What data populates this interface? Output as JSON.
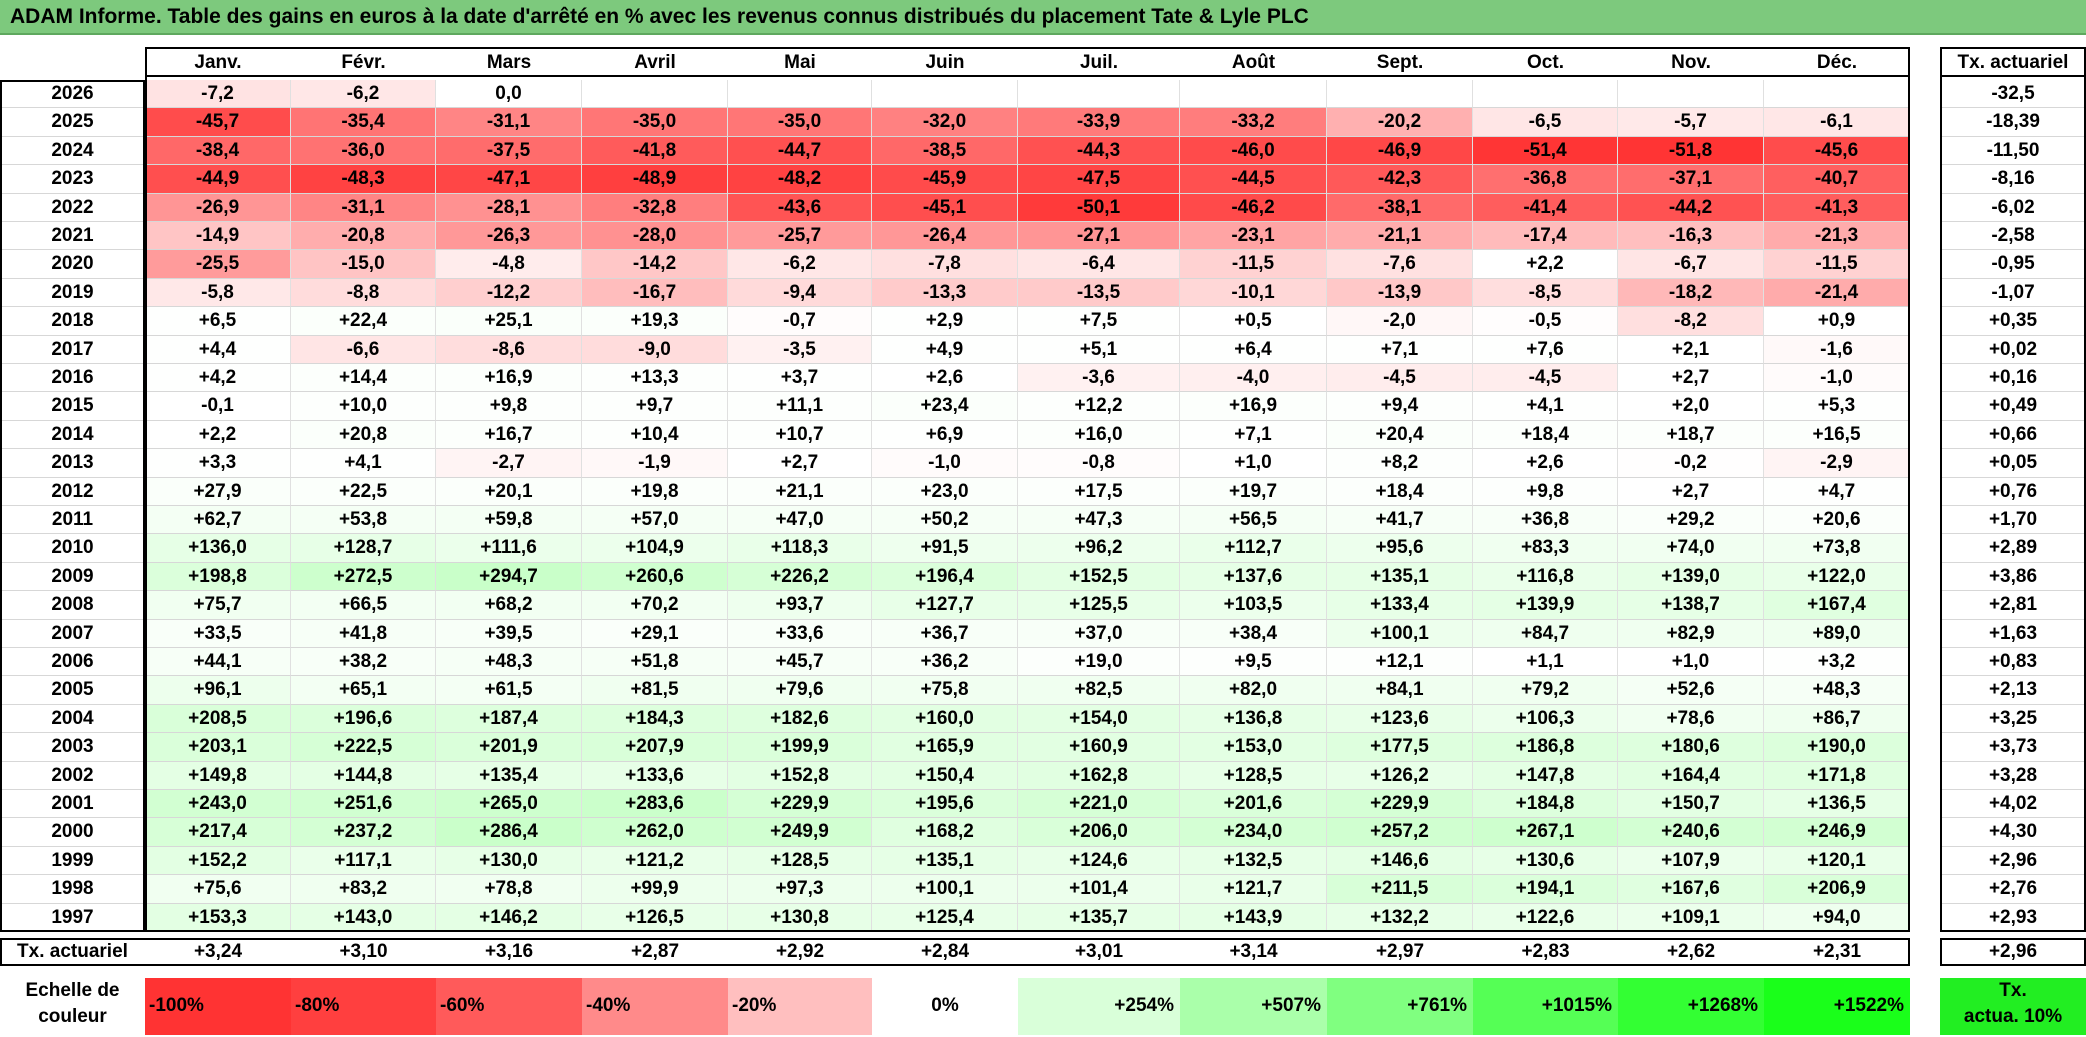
{
  "title": "ADAM Informe. Table des gains en euros à la date d'arrêté en % avec les revenus connus distribués du placement Tate & Lyle PLC",
  "months": [
    "Janv.",
    "Févr.",
    "Mars",
    "Avril",
    "Mai",
    "Juin",
    "Juil.",
    "Août",
    "Sept.",
    "Oct.",
    "Nov.",
    "Déc."
  ],
  "actuarial_header": "Tx. actuariel",
  "rows": [
    {
      "year": "2026",
      "values": [
        "-7,2",
        "-6,2",
        "0,0",
        "",
        "",
        "",
        "",
        "",
        "",
        "",
        "",
        ""
      ],
      "rate": "-32,5"
    },
    {
      "year": "2025",
      "values": [
        "-45,7",
        "-35,4",
        "-31,1",
        "-35,0",
        "-35,0",
        "-32,0",
        "-33,9",
        "-33,2",
        "-20,2",
        "-6,5",
        "-5,7",
        "-6,1"
      ],
      "rate": "-18,39"
    },
    {
      "year": "2024",
      "values": [
        "-38,4",
        "-36,0",
        "-37,5",
        "-41,8",
        "-44,7",
        "-38,5",
        "-44,3",
        "-46,0",
        "-46,9",
        "-51,4",
        "-51,8",
        "-45,6"
      ],
      "rate": "-11,50"
    },
    {
      "year": "2023",
      "values": [
        "-44,9",
        "-48,3",
        "-47,1",
        "-48,9",
        "-48,2",
        "-45,9",
        "-47,5",
        "-44,5",
        "-42,3",
        "-36,8",
        "-37,1",
        "-40,7"
      ],
      "rate": "-8,16"
    },
    {
      "year": "2022",
      "values": [
        "-26,9",
        "-31,1",
        "-28,1",
        "-32,8",
        "-43,6",
        "-45,1",
        "-50,1",
        "-46,2",
        "-38,1",
        "-41,4",
        "-44,2",
        "-41,3"
      ],
      "rate": "-6,02"
    },
    {
      "year": "2021",
      "values": [
        "-14,9",
        "-20,8",
        "-26,3",
        "-28,0",
        "-25,7",
        "-26,4",
        "-27,1",
        "-23,1",
        "-21,1",
        "-17,4",
        "-16,3",
        "-21,3"
      ],
      "rate": "-2,58"
    },
    {
      "year": "2020",
      "values": [
        "-25,5",
        "-15,0",
        "-4,8",
        "-14,2",
        "-6,2",
        "-7,8",
        "-6,4",
        "-11,5",
        "-7,6",
        "+2,2",
        "-6,7",
        "-11,5"
      ],
      "rate": "-0,95"
    },
    {
      "year": "2019",
      "values": [
        "-5,8",
        "-8,8",
        "-12,2",
        "-16,7",
        "-9,4",
        "-13,3",
        "-13,5",
        "-10,1",
        "-13,9",
        "-8,5",
        "-18,2",
        "-21,4"
      ],
      "rate": "-1,07"
    },
    {
      "year": "2018",
      "values": [
        "+6,5",
        "+22,4",
        "+25,1",
        "+19,3",
        "-0,7",
        "+2,9",
        "+7,5",
        "+0,5",
        "-2,0",
        "-0,5",
        "-8,2",
        "+0,9"
      ],
      "rate": "+0,35"
    },
    {
      "year": "2017",
      "values": [
        "+4,4",
        "-6,6",
        "-8,6",
        "-9,0",
        "-3,5",
        "+4,9",
        "+5,1",
        "+6,4",
        "+7,1",
        "+7,6",
        "+2,1",
        "-1,6"
      ],
      "rate": "+0,02"
    },
    {
      "year": "2016",
      "values": [
        "+4,2",
        "+14,4",
        "+16,9",
        "+13,3",
        "+3,7",
        "+2,6",
        "-3,6",
        "-4,0",
        "-4,5",
        "-4,5",
        "+2,7",
        "-1,0"
      ],
      "rate": "+0,16"
    },
    {
      "year": "2015",
      "values": [
        "-0,1",
        "+10,0",
        "+9,8",
        "+9,7",
        "+11,1",
        "+23,4",
        "+12,2",
        "+16,9",
        "+9,4",
        "+4,1",
        "+2,0",
        "+5,3"
      ],
      "rate": "+0,49"
    },
    {
      "year": "2014",
      "values": [
        "+2,2",
        "+20,8",
        "+16,7",
        "+10,4",
        "+10,7",
        "+6,9",
        "+16,0",
        "+7,1",
        "+20,4",
        "+18,4",
        "+18,7",
        "+16,5"
      ],
      "rate": "+0,66"
    },
    {
      "year": "2013",
      "values": [
        "+3,3",
        "+4,1",
        "-2,7",
        "-1,9",
        "+2,7",
        "-1,0",
        "-0,8",
        "+1,0",
        "+8,2",
        "+2,6",
        "-0,2",
        "-2,9"
      ],
      "rate": "+0,05"
    },
    {
      "year": "2012",
      "values": [
        "+27,9",
        "+22,5",
        "+20,1",
        "+19,8",
        "+21,1",
        "+23,0",
        "+17,5",
        "+19,7",
        "+18,4",
        "+9,8",
        "+2,7",
        "+4,7"
      ],
      "rate": "+0,76"
    },
    {
      "year": "2011",
      "values": [
        "+62,7",
        "+53,8",
        "+59,8",
        "+57,0",
        "+47,0",
        "+50,2",
        "+47,3",
        "+56,5",
        "+41,7",
        "+36,8",
        "+29,2",
        "+20,6"
      ],
      "rate": "+1,70"
    },
    {
      "year": "2010",
      "values": [
        "+136,0",
        "+128,7",
        "+111,6",
        "+104,9",
        "+118,3",
        "+91,5",
        "+96,2",
        "+112,7",
        "+95,6",
        "+83,3",
        "+74,0",
        "+73,8"
      ],
      "rate": "+2,89"
    },
    {
      "year": "2009",
      "values": [
        "+198,8",
        "+272,5",
        "+294,7",
        "+260,6",
        "+226,2",
        "+196,4",
        "+152,5",
        "+137,6",
        "+135,1",
        "+116,8",
        "+139,0",
        "+122,0"
      ],
      "rate": "+3,86"
    },
    {
      "year": "2008",
      "values": [
        "+75,7",
        "+66,5",
        "+68,2",
        "+70,2",
        "+93,7",
        "+127,7",
        "+125,5",
        "+103,5",
        "+133,4",
        "+139,9",
        "+138,7",
        "+167,4"
      ],
      "rate": "+2,81"
    },
    {
      "year": "2007",
      "values": [
        "+33,5",
        "+41,8",
        "+39,5",
        "+29,1",
        "+33,6",
        "+36,7",
        "+37,0",
        "+38,4",
        "+100,1",
        "+84,7",
        "+82,9",
        "+89,0"
      ],
      "rate": "+1,63"
    },
    {
      "year": "2006",
      "values": [
        "+44,1",
        "+38,2",
        "+48,3",
        "+51,8",
        "+45,7",
        "+36,2",
        "+19,0",
        "+9,5",
        "+12,1",
        "+1,1",
        "+1,0",
        "+3,2"
      ],
      "rate": "+0,83"
    },
    {
      "year": "2005",
      "values": [
        "+96,1",
        "+65,1",
        "+61,5",
        "+81,5",
        "+79,6",
        "+75,8",
        "+82,5",
        "+82,0",
        "+84,1",
        "+79,2",
        "+52,6",
        "+48,3"
      ],
      "rate": "+2,13"
    },
    {
      "year": "2004",
      "values": [
        "+208,5",
        "+196,6",
        "+187,4",
        "+184,3",
        "+182,6",
        "+160,0",
        "+154,0",
        "+136,8",
        "+123,6",
        "+106,3",
        "+78,6",
        "+86,7"
      ],
      "rate": "+3,25"
    },
    {
      "year": "2003",
      "values": [
        "+203,1",
        "+222,5",
        "+201,9",
        "+207,9",
        "+199,9",
        "+165,9",
        "+160,9",
        "+153,0",
        "+177,5",
        "+186,8",
        "+180,6",
        "+190,0"
      ],
      "rate": "+3,73"
    },
    {
      "year": "2002",
      "values": [
        "+149,8",
        "+144,8",
        "+135,4",
        "+133,6",
        "+152,8",
        "+150,4",
        "+162,8",
        "+128,5",
        "+126,2",
        "+147,8",
        "+164,4",
        "+171,8"
      ],
      "rate": "+3,28"
    },
    {
      "year": "2001",
      "values": [
        "+243,0",
        "+251,6",
        "+265,0",
        "+283,6",
        "+229,9",
        "+195,6",
        "+221,0",
        "+201,6",
        "+229,9",
        "+184,8",
        "+150,7",
        "+136,5"
      ],
      "rate": "+4,02"
    },
    {
      "year": "2000",
      "values": [
        "+217,4",
        "+237,2",
        "+286,4",
        "+262,0",
        "+249,9",
        "+168,2",
        "+206,0",
        "+234,0",
        "+257,2",
        "+267,1",
        "+240,6",
        "+246,9"
      ],
      "rate": "+4,30"
    },
    {
      "year": "1999",
      "values": [
        "+152,2",
        "+117,1",
        "+130,0",
        "+121,2",
        "+128,5",
        "+135,1",
        "+124,6",
        "+132,5",
        "+146,6",
        "+130,6",
        "+107,9",
        "+120,1"
      ],
      "rate": "+2,96"
    },
    {
      "year": "1998",
      "values": [
        "+75,6",
        "+83,2",
        "+78,8",
        "+99,9",
        "+97,3",
        "+100,1",
        "+101,4",
        "+121,7",
        "+211,5",
        "+194,1",
        "+167,6",
        "+206,9"
      ],
      "rate": "+2,76"
    },
    {
      "year": "1997",
      "values": [
        "+153,3",
        "+143,0",
        "+146,2",
        "+126,5",
        "+130,8",
        "+125,4",
        "+135,7",
        "+143,9",
        "+132,2",
        "+122,6",
        "+109,1",
        "+94,0"
      ],
      "rate": "+2,93"
    }
  ],
  "footer": {
    "label": "Tx. actuariel",
    "values": [
      "+3,24",
      "+3,10",
      "+3,16",
      "+2,87",
      "+2,92",
      "+2,84",
      "+3,01",
      "+3,14",
      "+2,97",
      "+2,83",
      "+2,62",
      "+2,31"
    ],
    "rate": "+2,96"
  },
  "scale": {
    "label_line1": "Echelle de",
    "label_line2": "couleur",
    "steps": [
      {
        "text": "-100%",
        "color": "#ff3333"
      },
      {
        "text": "-80%",
        "color": "#ff3f3f"
      },
      {
        "text": "-60%",
        "color": "#ff5a5a"
      },
      {
        "text": "-40%",
        "color": "#ff8a8a"
      },
      {
        "text": "-20%",
        "color": "#ffbfbf"
      },
      {
        "text": "0%",
        "color": "#ffffff"
      },
      {
        "text": "+254%",
        "color": "#d9ffd9"
      },
      {
        "text": "+507%",
        "color": "#aaffaa"
      },
      {
        "text": "+761%",
        "color": "#80ff80"
      },
      {
        "text": "+1015%",
        "color": "#55ff55"
      },
      {
        "text": "+1268%",
        "color": "#33ff33"
      },
      {
        "text": "+1522%",
        "color": "#1aff1a"
      }
    ],
    "actua_line1": "Tx.",
    "actua_line2": "actua. 10%",
    "actua_color": "#22ee22"
  },
  "colors": {
    "title_bg": "#7dc97d",
    "negative_full": "#ff3333",
    "positive_full": "#33ff33"
  }
}
